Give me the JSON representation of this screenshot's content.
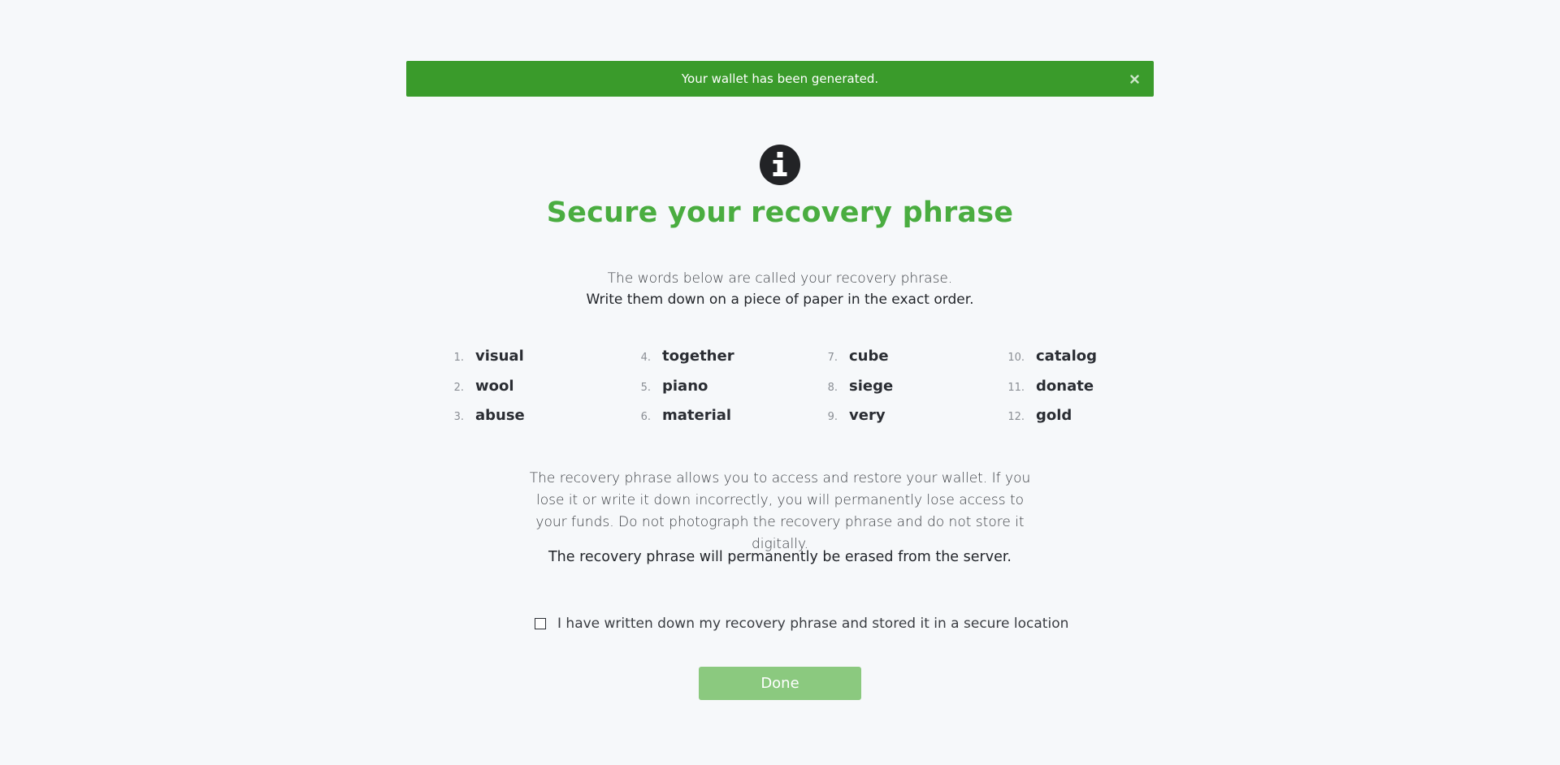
{
  "alert": {
    "message": "Your wallet has been generated.",
    "close_glyph": "×",
    "color": "#3a9b2b"
  },
  "header": {
    "icon": "info-icon",
    "title": "Secure your recovery phrase",
    "title_color": "#4aad40"
  },
  "intro": {
    "line1": "The words below are called your recovery phrase.",
    "line2": "Write them down on a piece of paper in the exact order."
  },
  "recovery_phrase": [
    {
      "num": "1.",
      "word": "visual"
    },
    {
      "num": "2.",
      "word": "wool"
    },
    {
      "num": "3.",
      "word": "abuse"
    },
    {
      "num": "4.",
      "word": "together"
    },
    {
      "num": "5.",
      "word": "piano"
    },
    {
      "num": "6.",
      "word": "material"
    },
    {
      "num": "7.",
      "word": "cube"
    },
    {
      "num": "8.",
      "word": "siege"
    },
    {
      "num": "9.",
      "word": "very"
    },
    {
      "num": "10.",
      "word": "catalog"
    },
    {
      "num": "11.",
      "word": "donate"
    },
    {
      "num": "12.",
      "word": "gold"
    }
  ],
  "warning": {
    "text": "The recovery phrase allows you to access and restore your wallet. If you lose it or write it down incorrectly, you will permanently lose access to your funds. Do not photograph the recovery phrase and do not store it digitally.",
    "erase_notice": "The recovery phrase will permanently be erased from the server."
  },
  "confirm": {
    "label": "I have written down my recovery phrase and stored it in a secure location",
    "checked": false
  },
  "done_button": {
    "label": "Done",
    "color": "#8bc97f"
  }
}
